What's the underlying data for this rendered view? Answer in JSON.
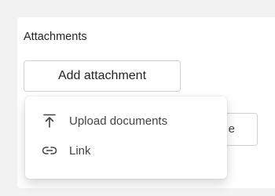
{
  "section": {
    "title": "Attachments"
  },
  "actions": {
    "add_label": "Add attachment",
    "behind_label": "e"
  },
  "menu": {
    "items": [
      {
        "label": "Upload documents",
        "icon": "upload-icon"
      },
      {
        "label": "Link",
        "icon": "link-icon"
      }
    ]
  },
  "colors": {
    "accent": "#5b5fc7",
    "text": "#242424",
    "background": "#f2f2f2"
  }
}
